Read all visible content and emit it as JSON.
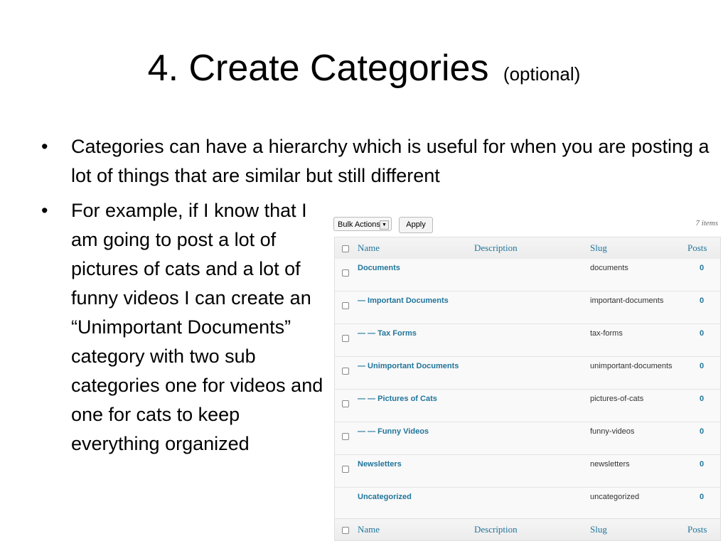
{
  "slide": {
    "title": "4. Create Categories",
    "title_sub": "(optional)",
    "bullets": [
      "Categories can have a hierarchy which is useful for when you are posting a lot of things that are similar but still different",
      "For example, if I know that I am going to post a lot of pictures of cats and a lot of funny videos I can create an “Unimportant Documents” category with two sub categories one for videos and one for cats to keep everything organized"
    ]
  },
  "toolbar": {
    "bulk_actions": "Bulk Actions",
    "apply": "Apply",
    "item_count": "7 items"
  },
  "columns": {
    "name": "Name",
    "description": "Description",
    "slug": "Slug",
    "posts": "Posts"
  },
  "rows": [
    {
      "name": "Documents",
      "slug": "documents",
      "posts": "0",
      "checkbox": true
    },
    {
      "name": "— Important Documents",
      "slug": "important-documents",
      "posts": "0",
      "checkbox": true
    },
    {
      "name": "— — Tax Forms",
      "slug": "tax-forms",
      "posts": "0",
      "checkbox": true
    },
    {
      "name": "— Unimportant Documents",
      "slug": "unimportant-documents",
      "posts": "0",
      "checkbox": true
    },
    {
      "name": "— — Pictures of Cats",
      "slug": "pictures-of-cats",
      "posts": "0",
      "checkbox": true
    },
    {
      "name": "— — Funny Videos",
      "slug": "funny-videos",
      "posts": "0",
      "checkbox": true
    },
    {
      "name": "Newsletters",
      "slug": "newsletters",
      "posts": "0",
      "checkbox": true
    },
    {
      "name": "Uncategorized",
      "slug": "uncategorized",
      "posts": "0",
      "checkbox": false
    }
  ],
  "colors": {
    "link": "#21759b",
    "header_bg": "#ececec",
    "row_bg": "#f9f9f9",
    "border": "#dfdfdf"
  }
}
